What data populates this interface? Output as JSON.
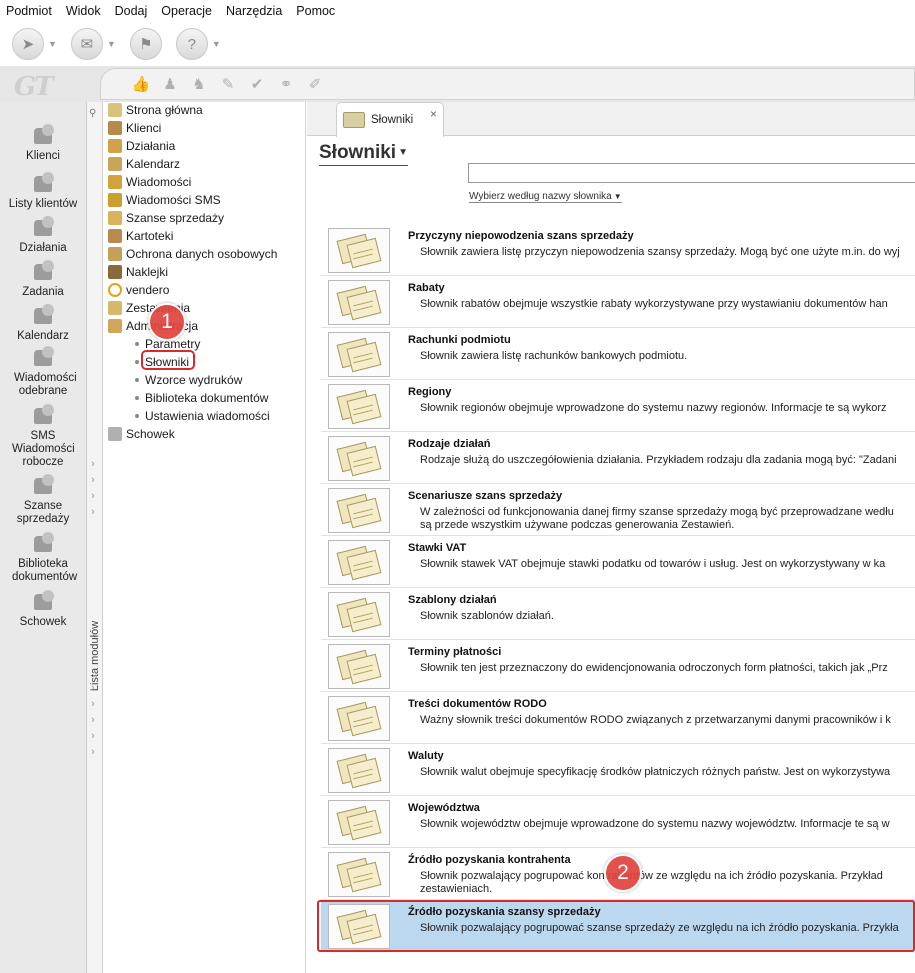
{
  "menu": [
    "Podmiot",
    "Widok",
    "Dodaj",
    "Operacje",
    "Narzędzia",
    "Pomoc"
  ],
  "toolbar": {
    "buttons": [
      {
        "icon": "nav-arrow-icon"
      },
      {
        "icon": "envelope-icon"
      },
      {
        "icon": "stamp-icon"
      },
      {
        "icon": "help-icon"
      }
    ],
    "sub_icons": [
      "thumbs-up-icon",
      "person-icon",
      "people-icon",
      "wrench-icon",
      "check-icon",
      "network-icon",
      "tag-icon"
    ]
  },
  "logo": "GT",
  "modules": [
    {
      "label": "Klienci",
      "icon": "clients-icon"
    },
    {
      "label": "Listy klientów",
      "icon": "client-lists-icon"
    },
    {
      "label": "Działania",
      "icon": "actions-icon"
    },
    {
      "label": "Zadania",
      "icon": "tasks-icon"
    },
    {
      "label": "Kalendarz",
      "icon": "calendar-icon"
    },
    {
      "label": "Wiadomości odebrane",
      "icon": "inbox-icon"
    },
    {
      "label": "SMS Wiadomości robocze",
      "icon": "sms-icon"
    },
    {
      "label": "Szanse sprzedaży",
      "icon": "sales-chances-icon"
    },
    {
      "label": "Biblioteka dokumentów",
      "icon": "document-library-icon"
    },
    {
      "label": "Schowek",
      "icon": "clipboard-icon"
    }
  ],
  "vertical_panel": {
    "label": "Lista modułów"
  },
  "tree": {
    "nodes": [
      {
        "label": "Strona główna",
        "color": "#d9c27a"
      },
      {
        "label": "Klienci",
        "color": "#b58a4a"
      },
      {
        "label": "Działania",
        "color": "#d1a24a"
      },
      {
        "label": "Kalendarz",
        "color": "#c9a45b"
      },
      {
        "label": "Wiadomości",
        "color": "#d3a23b"
      },
      {
        "label": "Wiadomości SMS",
        "color": "#c9a030"
      },
      {
        "label": "Szanse sprzedaży",
        "color": "#d8b35a"
      },
      {
        "label": "Kartoteki",
        "color": "#b98a4e"
      },
      {
        "label": "Ochrona danych osobowych",
        "color": "#c4a05a"
      },
      {
        "label": "Naklejki",
        "color": "#8a6a3a"
      },
      {
        "label": "vendero",
        "color": "#e3a21a"
      },
      {
        "label": "Zestawienia",
        "color": "#d6b86a"
      },
      {
        "label": "Administracja",
        "color": "#d0a65a"
      }
    ],
    "children": [
      "Parametry",
      "Słowniki",
      "Wzorce wydruków",
      "Biblioteka dokumentów",
      "Ustawienia wiadomości"
    ],
    "last_node": {
      "label": "Schowek",
      "color": "#b0b0b0"
    }
  },
  "badges": {
    "one": "1",
    "two": "2"
  },
  "tab": {
    "label": "Słowniki",
    "close": "×"
  },
  "page": {
    "title": "Słowniki",
    "search_value": "",
    "search_type": "Wybierz według nazwy słownika"
  },
  "colors": {
    "highlight": "#d92b2b",
    "selected_row": "#bcd8ef",
    "badge": "#e0443f"
  },
  "dictionaries": [
    {
      "title": "Przyczyny niepowodzenia szans sprzedaży",
      "desc": "Słownik zawiera listę przyczyn niepowodzenia szansy sprzedaży. Mogą być one użyte m.in. do wyj"
    },
    {
      "title": "Rabaty",
      "desc": "Słownik rabatów obejmuje wszystkie rabaty wykorzystywane przy wystawianiu dokumentów han"
    },
    {
      "title": "Rachunki podmiotu",
      "desc": "Słownik zawiera listę rachunków bankowych podmiotu."
    },
    {
      "title": "Regiony",
      "desc": "Słownik regionów obejmuje wprowadzone do systemu nazwy regionów. Informacje te są wykorz"
    },
    {
      "title": "Rodzaje działań",
      "desc": "Rodzaje służą do uszczegółowienia działania. Przykładem rodzaju dla zadania mogą być: \"Zadani"
    },
    {
      "title": "Scenariusze szans sprzedaży",
      "desc": "W zależności od funkcjonowania danej firmy szanse sprzedaży mogą być przeprowadzane wedłu",
      "desc2": "są przede wszystkim używane podczas generowania Zestawień."
    },
    {
      "title": "Stawki VAT",
      "desc": "Słownik stawek VAT obejmuje stawki podatku od towarów i usług. Jest on wykorzystywany w ka"
    },
    {
      "title": "Szablony działań",
      "desc": "Słownik szablonów działań."
    },
    {
      "title": "Terminy płatności",
      "desc": "Słownik ten jest przeznaczony do ewidencjonowania odroczonych form płatności, takich jak „Prz"
    },
    {
      "title": "Treści dokumentów RODO",
      "desc": "Ważny słownik treści dokumentów RODO związanych z przetwarzanymi danymi pracowników i k"
    },
    {
      "title": "Waluty",
      "desc": "Słownik walut obejmuje specyfikację środków płatniczych różnych państw. Jest on wykorzystywa"
    },
    {
      "title": "Województwa",
      "desc": "Słownik województw obejmuje wprowadzone do systemu nazwy województw. Informacje te są w"
    },
    {
      "title": "Źródło pozyskania kontrahenta",
      "desc": "Słownik pozwalający pogrupować kontrahentów ze względu na ich źródło pozyskania. Przykład",
      "desc2": "zestawieniach."
    },
    {
      "title": "Źródło pozyskania szansy sprzedaży",
      "desc": "Słownik pozwalający pogrupować szanse sprzedaży ze względu na ich źródło pozyskania. Przykła"
    }
  ]
}
